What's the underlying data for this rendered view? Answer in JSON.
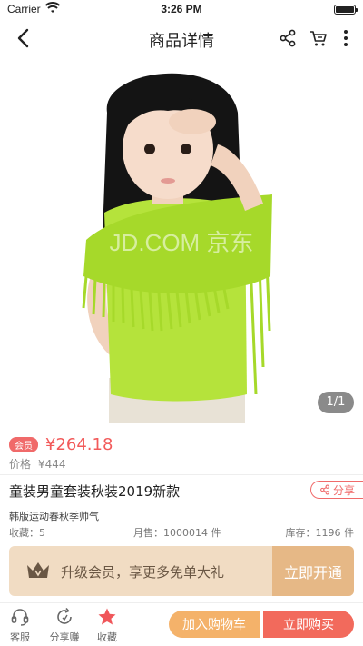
{
  "status": {
    "carrier": "Carrier",
    "time": "3:26 PM"
  },
  "nav": {
    "title": "商品详情",
    "icons": [
      "back-icon",
      "share-icon",
      "cart-icon",
      "more-icon"
    ]
  },
  "gallery": {
    "counter": "1/1",
    "watermark": "JD.COM 京东"
  },
  "product": {
    "vip_badge": "会员",
    "vip_price": "¥264.18",
    "orig_label": "价格",
    "orig_price": "¥444",
    "title": "童装男童套装秋装2019新款",
    "share_label": "分享",
    "subtitle": "韩版运动春秋季帅气",
    "stats": {
      "favorites": "收藏：5",
      "monthly_sales": "月售：1000014 件",
      "stock": "库存：1196 件"
    }
  },
  "member_banner": {
    "text": "升级会员，享更多免单大礼",
    "button": "立即开通"
  },
  "bottom": {
    "tabs": [
      {
        "label": "客服",
        "icon": "headset-icon"
      },
      {
        "label": "分享赚",
        "icon": "share-earn-icon"
      },
      {
        "label": "收藏",
        "icon": "star-icon"
      }
    ],
    "add_cart": "加入购物车",
    "buy_now": "立即购买"
  },
  "colors": {
    "accent_red": "#f25a5a",
    "gold": "#e6b886",
    "orange": "#f4b26a"
  }
}
